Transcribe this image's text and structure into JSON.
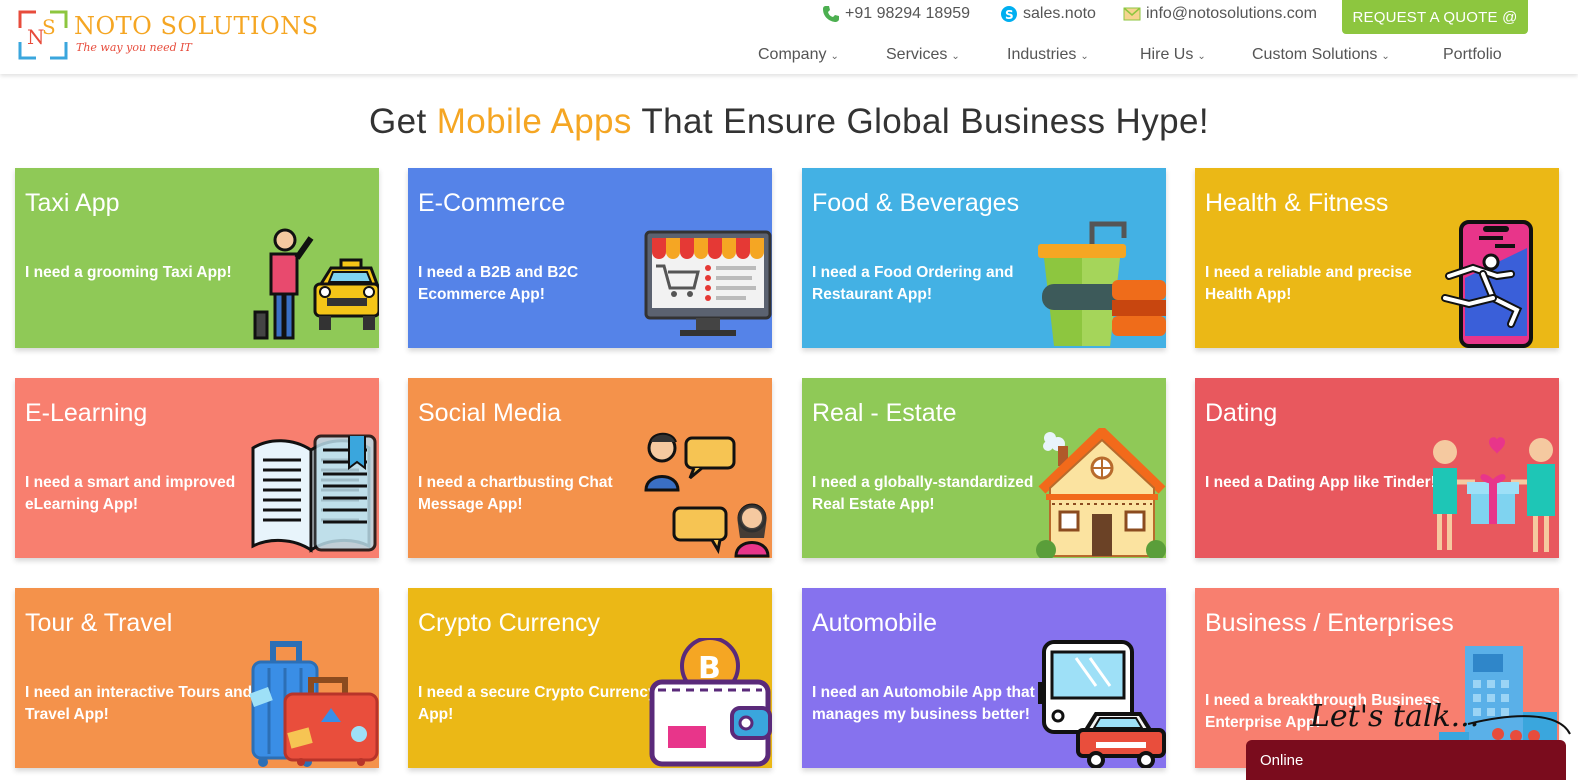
{
  "brand": {
    "name": "NOTO SOLUTIONS",
    "tagline": "The way you need IT",
    "colors": {
      "orange": "#f5a623",
      "red": "#e74c3c",
      "green": "#8dc63f",
      "blue": "#3aa6dd"
    }
  },
  "contacts": {
    "phone": "+91 98294 18959",
    "skype": "sales.noto",
    "email": "info@notosolutions.com"
  },
  "quote_button": "REQUEST A QUOTE @",
  "nav": [
    {
      "label": "Company",
      "dropdown": true
    },
    {
      "label": "Services",
      "dropdown": true
    },
    {
      "label": "Industries",
      "dropdown": true
    },
    {
      "label": "Hire Us",
      "dropdown": true
    },
    {
      "label": "Custom Solutions",
      "dropdown": true
    },
    {
      "label": "Portfolio",
      "dropdown": false
    }
  ],
  "headline": {
    "prefix": "Get",
    "highlight": "Mobile Apps",
    "suffix": "That Ensure Global Business Hype!"
  },
  "cards": [
    {
      "title": "Taxi App",
      "desc": "I need a grooming Taxi App!",
      "color": "#8fc957",
      "icon": "taxi-icon"
    },
    {
      "title": "E-Commerce",
      "desc": "I need a B2B and B2C Ecommerce App!",
      "color": "#5583e8",
      "icon": "ecommerce-monitor-icon"
    },
    {
      "title": "Food & Beverages",
      "desc": "I need a Food Ordering and Restaurant App!",
      "color": "#43b1e4",
      "icon": "drink-cup-icon"
    },
    {
      "title": "Health & Fitness",
      "desc": "I need a reliable and precise Health App!",
      "color": "#ebb816",
      "icon": "fitness-phone-icon"
    },
    {
      "title": "E-Learning",
      "desc": "I need a smart and improved eLearning App!",
      "color": "#f87f6f",
      "icon": "open-book-icon"
    },
    {
      "title": "Social Media",
      "desc": "I need a chartbusting Chat Message App!",
      "color": "#f4924b",
      "icon": "chat-bubbles-icon"
    },
    {
      "title": "Real - Estate",
      "desc": "I need a globally-standardized Real Estate App!",
      "color": "#8fc957",
      "icon": "house-icon"
    },
    {
      "title": "Dating",
      "desc": "I need a Dating App like Tinder!",
      "color": "#e8585e",
      "icon": "couple-gift-icon"
    },
    {
      "title": "Tour & Travel",
      "desc": "I need an interactive Tours and Travel App!",
      "color": "#f4924b",
      "icon": "luggage-icon"
    },
    {
      "title": "Crypto Currency",
      "desc": "I need a secure Crypto Currency App!",
      "color": "#ebb816",
      "icon": "bitcoin-wallet-icon"
    },
    {
      "title": "Automobile",
      "desc": "I need an Automobile App that manages my business better!",
      "color": "#8672ee",
      "icon": "bus-car-icon"
    },
    {
      "title": "Business / Enterprises",
      "desc": "I need a breakthrough Business Enterprise App!",
      "color": "#f87f6f",
      "icon": "office-building-icon"
    }
  ],
  "chat": {
    "teaser": "Let's talk...",
    "status": "Online"
  }
}
